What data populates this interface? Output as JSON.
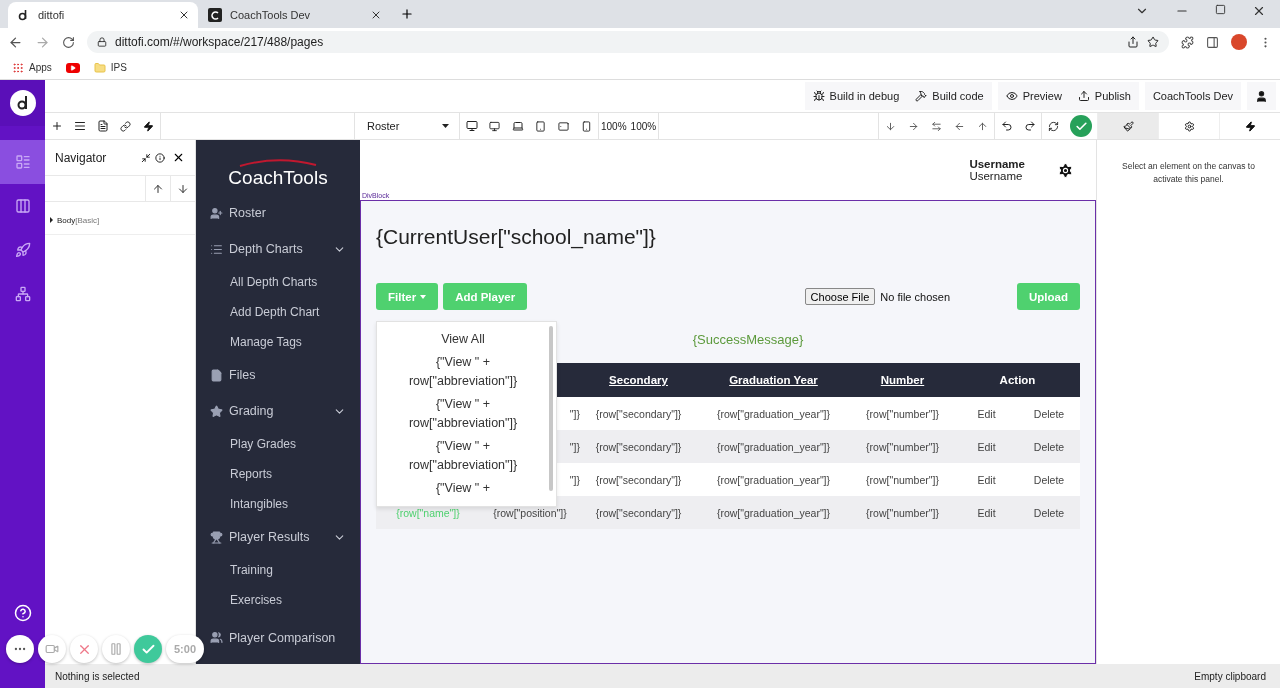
{
  "browser": {
    "tabs": [
      {
        "title": "dittofi",
        "kind": "dittofi",
        "selected": true
      },
      {
        "title": "CoachTools Dev",
        "kind": "coachtools",
        "selected": false
      }
    ],
    "url": "dittofi.com/#/workspace/217/488/pages",
    "bookmarks": [
      {
        "kind": "apps",
        "label": "Apps"
      },
      {
        "kind": "video"
      },
      {
        "kind": "folder",
        "label": "IPS"
      }
    ]
  },
  "rail": {
    "items": [
      {
        "kind": "pages",
        "selected": true
      },
      {
        "kind": "grid",
        "selected": false
      },
      {
        "kind": "api",
        "selected": false
      },
      {
        "kind": "network",
        "selected": false
      }
    ]
  },
  "topbar": {
    "buttons": [
      {
        "kind": "bug",
        "label": "Build in debug"
      },
      {
        "kind": "hammer",
        "label": "Build code"
      },
      {
        "kind": "eye",
        "label": "Preview"
      },
      {
        "kind": "upload",
        "label": "Publish"
      },
      {
        "kind": "plain",
        "label": "CoachTools Dev"
      }
    ]
  },
  "toolbar": {
    "page_select": "Roster",
    "zoom": [
      "100%",
      "100%"
    ],
    "status_ok": true,
    "panel_tabs": [
      {
        "kind": "brush",
        "selected": true
      },
      {
        "kind": "gear",
        "selected": false
      },
      {
        "kind": "bolt",
        "selected": false
      }
    ]
  },
  "navigator": {
    "title": "Navigator",
    "tree": [
      {
        "label": "Body",
        "tag": "[Basic]",
        "expanded": false
      }
    ]
  },
  "app": {
    "logo": "CoachTools",
    "menu": [
      {
        "label": "Roster",
        "kind": "user-plus"
      },
      {
        "label": "Depth Charts",
        "kind": "list",
        "expanded": true,
        "children": [
          {
            "label": "All Depth Charts"
          },
          {
            "label": "Add Depth Chart"
          },
          {
            "label": "Manage Tags"
          }
        ]
      },
      {
        "label": "Files",
        "kind": "file"
      },
      {
        "label": "Grading",
        "kind": "star",
        "expanded": true,
        "children": [
          {
            "label": "Play Grades"
          },
          {
            "label": "Reports"
          },
          {
            "label": "Intangibles"
          }
        ]
      },
      {
        "label": "Player Results",
        "kind": "trophy",
        "expanded": true,
        "children": [
          {
            "label": "Training"
          },
          {
            "label": "Exercises"
          }
        ]
      },
      {
        "label": "Player Comparison",
        "kind": "users"
      }
    ],
    "user_name": "Username",
    "user_role": "Username",
    "frame_label": "DivBlock",
    "heading": "{CurrentUser[\"school_name\"]}",
    "filter_button": "Filter",
    "add_button": "Add Player",
    "file_input": {
      "button": "Choose File",
      "status": "No file chosen"
    },
    "upload_button": "Upload",
    "success_message": "{SuccessMessage}",
    "filter_menu": {
      "items": [
        "View All",
        "{\"View \" + row[\"abbreviation\"]}",
        "{\"View \" + row[\"abbreviation\"]}",
        "{\"View \" + row[\"abbreviation\"]}",
        "{\"View \" +"
      ]
    },
    "table": {
      "columns": [
        "Secondary",
        "Graduation Year",
        "Number",
        "Action"
      ],
      "rows": [
        {
          "column_2": "\"]}",
          "secondary": "{row[\"secondary\"]}",
          "graduation_year": "{row[\"graduation_year\"]}",
          "number": "{row[\"number\"]}",
          "edit": "Edit",
          "delete": "Delete"
        },
        {
          "column_2": "\"]}",
          "secondary": "{row[\"secondary\"]}",
          "graduation_year": "{row[\"graduation_year\"]}",
          "number": "{row[\"number\"]}",
          "edit": "Edit",
          "delete": "Delete"
        },
        {
          "column_2": "\"]}",
          "secondary": "{row[\"secondary\"]}",
          "graduation_year": "{row[\"graduation_year\"]}",
          "number": "{row[\"number\"]}",
          "edit": "Edit",
          "delete": "Delete"
        },
        {
          "column_1": "{row[\"name\"]}",
          "column_2": "{row[\"position\"]}",
          "secondary": "{row[\"secondary\"]}",
          "graduation_year": "{row[\"graduation_year\"]}",
          "number": "{row[\"number\"]}",
          "edit": "Edit",
          "delete": "Delete"
        }
      ]
    }
  },
  "properties_panel": {
    "hint": "Select an element on the canvas to activate this panel."
  },
  "status_bar": {
    "left": "Nothing is selected",
    "right": "Empty clipboard"
  },
  "recorder": {
    "timer": "5:00"
  }
}
